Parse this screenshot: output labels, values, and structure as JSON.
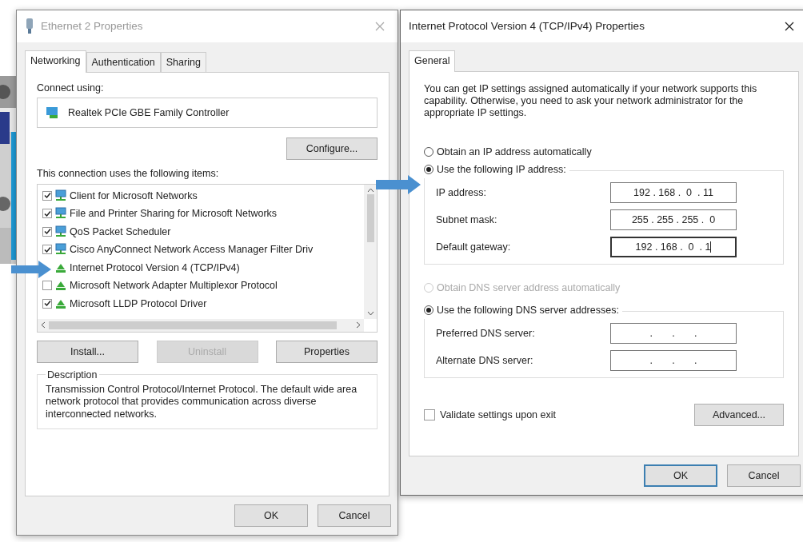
{
  "left_window": {
    "title": "Ethernet 2 Properties",
    "active": false,
    "tabs": [
      {
        "label": "Networking",
        "selected": true
      },
      {
        "label": "Authentication",
        "selected": false
      },
      {
        "label": "Sharing",
        "selected": false
      }
    ],
    "connect_label": "Connect using:",
    "adapter": "Realtek PCIe GBE Family Controller",
    "configure_button": "Configure...",
    "items_label": "This connection uses the following items:",
    "items": [
      {
        "label": "Client for Microsoft Networks",
        "kind": "client",
        "checked": true
      },
      {
        "label": "File and Printer Sharing for Microsoft Networks",
        "kind": "client",
        "checked": true
      },
      {
        "label": "QoS Packet Scheduler",
        "kind": "client",
        "checked": true
      },
      {
        "label": "Cisco AnyConnect Network Access Manager Filter Driv",
        "kind": "client",
        "checked": true
      },
      {
        "label": "Internet Protocol Version 4 (TCP/IPv4)",
        "kind": "protocol"
      },
      {
        "label": "Microsoft Network Adapter Multiplexor Protocol",
        "kind": "protocol",
        "checked": false
      },
      {
        "label": "Microsoft LLDP Protocol Driver",
        "kind": "protocol",
        "checked": true
      }
    ],
    "buttons": [
      {
        "label": "Install...",
        "disabled": false
      },
      {
        "label": "Uninstall",
        "disabled": true
      },
      {
        "label": "Properties",
        "disabled": false
      }
    ],
    "description_title": "Description",
    "description": "Transmission Control Protocol/Internet Protocol. The default wide area network protocol that provides communication across diverse interconnected networks.",
    "footer_buttons": [
      {
        "label": "OK",
        "default": false
      },
      {
        "label": "Cancel",
        "default": false
      }
    ]
  },
  "right_window": {
    "title": "Internet Protocol Version 4 (TCP/IPv4) Properties",
    "active": true,
    "tabs": [
      {
        "label": "General",
        "selected": true
      }
    ],
    "intro": "You can get IP settings assigned automatically if your network supports this capability. Otherwise, you need to ask your network administrator for the appropriate IP settings.",
    "ip_auto": {
      "label": "Obtain an IP address automatically",
      "selected": false,
      "disabled": false
    },
    "ip_manual": {
      "label": "Use the following IP address:",
      "selected": true,
      "disabled": false
    },
    "ip_fields": [
      {
        "label": "IP address:",
        "value": "192 . 168 .  0  . 11",
        "focused": false
      },
      {
        "label": "Subnet mask:",
        "value": "255 . 255 . 255 .  0",
        "focused": false
      },
      {
        "label": "Default gateway:",
        "value": "192 . 168 .  0  . 1",
        "focused": true
      }
    ],
    "dns_auto": {
      "label": "Obtain DNS server address automatically",
      "selected": false,
      "disabled": true
    },
    "dns_manual": {
      "label": "Use the following DNS server addresses:",
      "selected": true,
      "disabled": false
    },
    "dns_fields": [
      {
        "label": "Preferred DNS server:",
        "value": ".       .       .",
        "focused": false
      },
      {
        "label": "Alternate DNS server:",
        "value": ".       .       .",
        "focused": false
      }
    ],
    "validate": {
      "label": "Validate settings upon exit",
      "checked": false
    },
    "advanced_button": "Advanced...",
    "footer_buttons": [
      {
        "label": "OK",
        "default": true
      },
      {
        "label": "Cancel",
        "default": false
      }
    ]
  }
}
